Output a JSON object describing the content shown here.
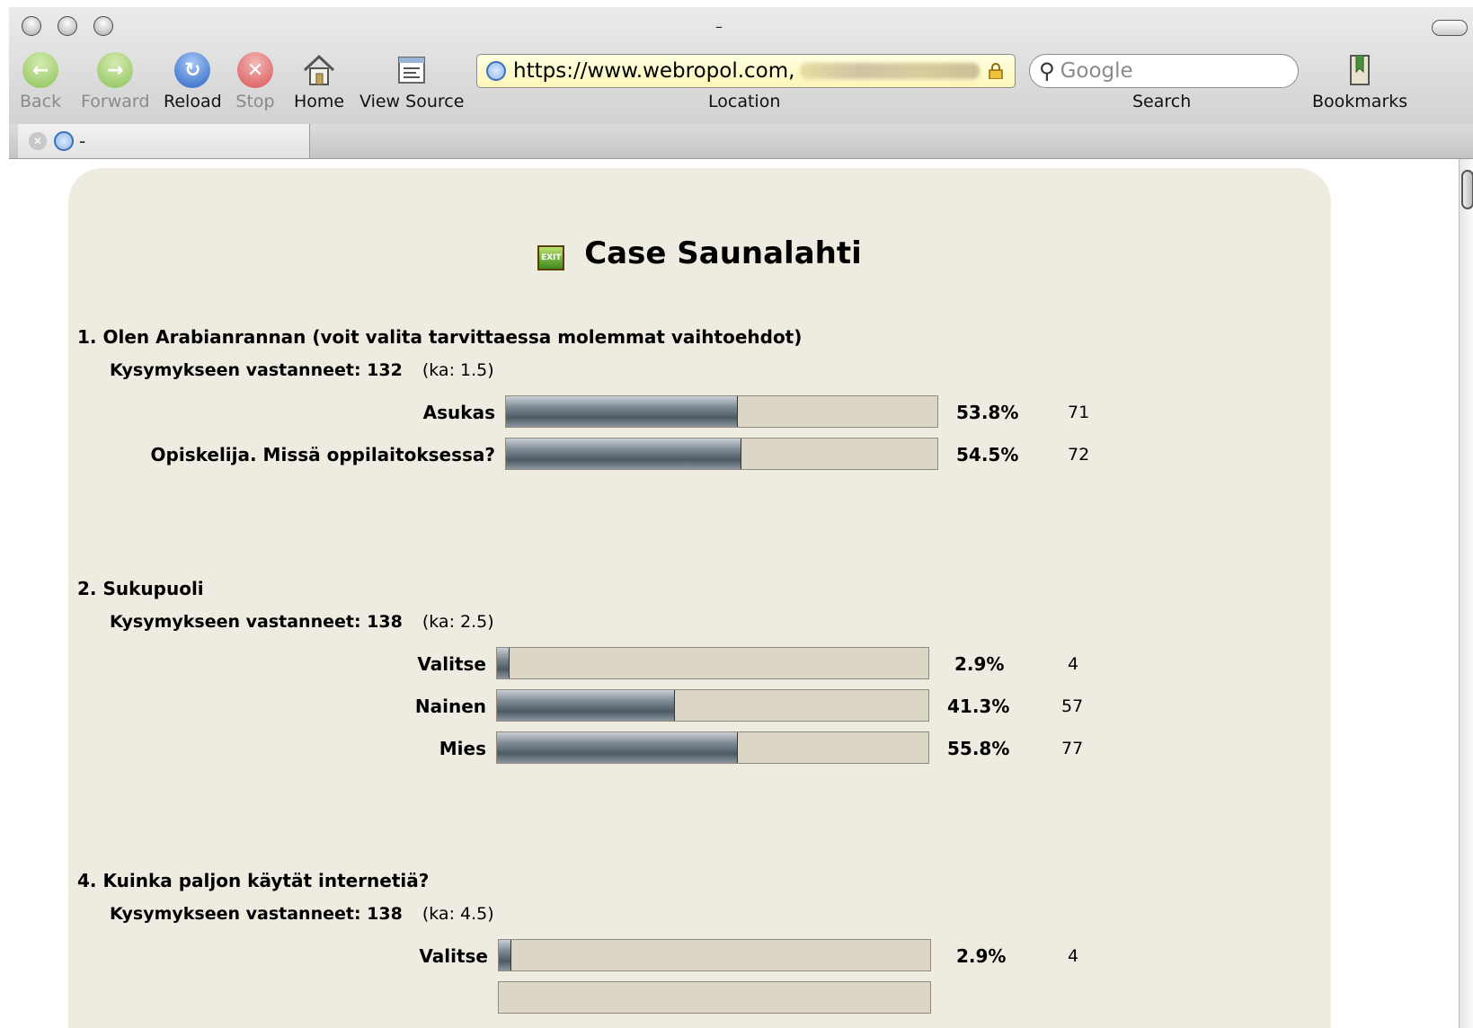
{
  "window": {
    "title": "–"
  },
  "toolbar": {
    "back": "Back",
    "forward": "Forward",
    "reload": "Reload",
    "stop": "Stop",
    "home": "Home",
    "view_source": "View Source",
    "location_label": "Location",
    "url": "https://www.webropol.com,",
    "search_label": "Search",
    "search_placeholder": "Google",
    "bookmarks": "Bookmarks"
  },
  "tab": {
    "title": "-"
  },
  "page": {
    "title": "Case Saunalahti",
    "questions": [
      {
        "title": "1. Olen Arabianrannan (voit valita tarvittaessa molemmat vaihtoehdot)",
        "respondents_label": "Kysymykseen vastanneet: 132",
        "average": "(ka: 1.5)",
        "options": [
          {
            "label": "Asukas",
            "percent": "53.8%",
            "count": "71",
            "fraction": 0.538
          },
          {
            "label": "Opiskelija. Missä oppilaitoksessa?",
            "percent": "54.5%",
            "count": "72",
            "fraction": 0.545
          }
        ]
      },
      {
        "title": "2. Sukupuoli",
        "respondents_label": "Kysymykseen vastanneet: 138",
        "average": "(ka: 2.5)",
        "options": [
          {
            "label": "Valitse",
            "percent": "2.9%",
            "count": "4",
            "fraction": 0.029
          },
          {
            "label": "Nainen",
            "percent": "41.3%",
            "count": "57",
            "fraction": 0.413
          },
          {
            "label": "Mies",
            "percent": "55.8%",
            "count": "77",
            "fraction": 0.558
          }
        ]
      },
      {
        "title": "4. Kuinka paljon käytät internetiä?",
        "respondents_label": "Kysymykseen vastanneet: 138",
        "average": "(ka: 4.5)",
        "options": [
          {
            "label": "Valitse",
            "percent": "2.9%",
            "count": "4",
            "fraction": 0.029
          }
        ]
      }
    ]
  }
}
